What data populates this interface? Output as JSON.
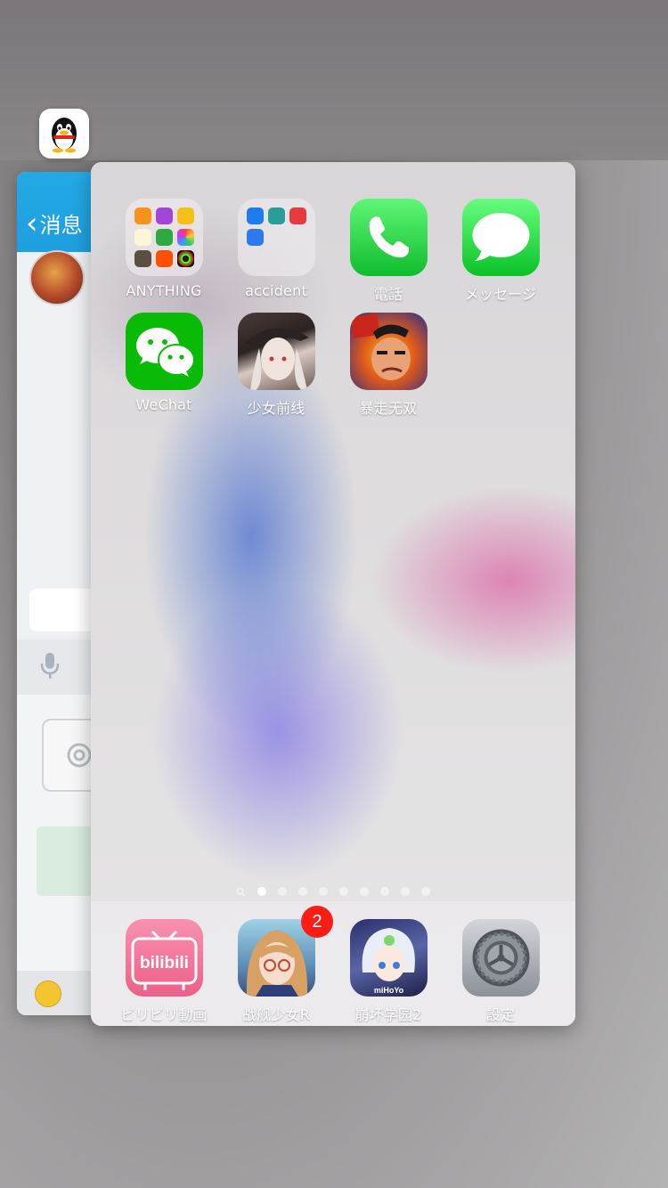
{
  "background_app": {
    "name": "QQ",
    "back_label": "消息"
  },
  "home_screen": {
    "apps": [
      {
        "label": "ANYTHING",
        "type": "folder"
      },
      {
        "label": "accident",
        "type": "folder"
      },
      {
        "label": "電話",
        "icon": "phone-icon"
      },
      {
        "label": "メッセージ",
        "icon": "messages-icon"
      },
      {
        "label": "WeChat",
        "icon": "wechat-icon"
      },
      {
        "label": "少女前线",
        "icon": "girls-frontline-icon"
      },
      {
        "label": "暴走无双",
        "icon": "baozou-wushuang-icon"
      }
    ],
    "page_count": 9,
    "active_page": 1,
    "dock": [
      {
        "label": "ビリビリ動画",
        "icon": "bilibili-icon",
        "icon_text": "bilibili"
      },
      {
        "label": "战舰少女R",
        "icon": "warship-girls-icon",
        "badge": "2"
      },
      {
        "label": "崩坏学园2",
        "icon": "honkai-gakuen-2-icon",
        "icon_text": "miHoYo"
      },
      {
        "label": "設定",
        "icon": "settings-icon"
      }
    ]
  },
  "colors": {
    "badge": "#fe1c17",
    "qq_header": "#23a9e6",
    "phone_green": "#34c84a",
    "wechat_green": "#09bb07",
    "bilibili_pink": "#f06c93"
  }
}
